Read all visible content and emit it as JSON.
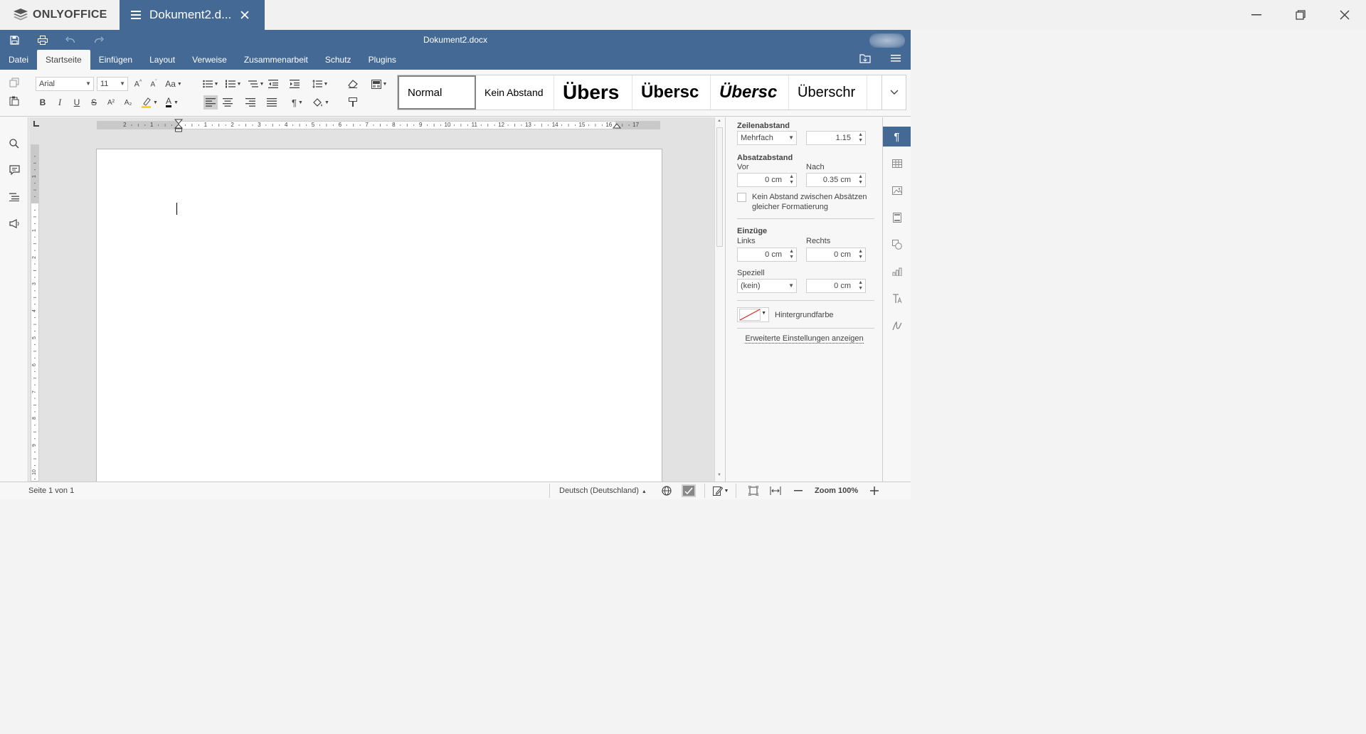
{
  "window": {
    "app_name": "ONLYOFFICE",
    "tab_title": "Dokument2.d..."
  },
  "header": {
    "doc_title": "Dokument2.docx",
    "tabs": [
      "Datei",
      "Startseite",
      "Einfügen",
      "Layout",
      "Verweise",
      "Zusammenarbeit",
      "Schutz",
      "Plugins"
    ],
    "active_tab": "Startseite"
  },
  "toolbar": {
    "font_name": "Arial",
    "font_size": "11",
    "case_label": "Aa",
    "bold": "B",
    "italic": "I",
    "underline": "U",
    "strike": "S",
    "superscript": "A²",
    "subscript": "A₂",
    "font_color_label": "A",
    "styles": [
      "Normal",
      "Kein Abstand",
      "Übers",
      "Übersc",
      "Übersc",
      "Überschr"
    ],
    "selected_style": "Normal"
  },
  "ruler": {
    "h_labels": [
      "2",
      "1",
      "1",
      "2",
      "3",
      "4",
      "5",
      "6",
      "7",
      "8",
      "9",
      "10",
      "11",
      "12",
      "13",
      "14",
      "15",
      "16",
      "17"
    ],
    "v_labels": [
      "1",
      "1",
      "2",
      "3",
      "4",
      "5",
      "6",
      "7",
      "8",
      "9",
      "10"
    ]
  },
  "right_panel": {
    "line_spacing_title": "Zeilenabstand",
    "line_spacing_mode": "Mehrfach",
    "line_spacing_value": "1.15",
    "para_spacing_title": "Absatzabstand",
    "before_label": "Vor",
    "after_label": "Nach",
    "before_value": "0 cm",
    "after_value": "0.35 cm",
    "no_space_checkbox": "Kein Abstand zwischen Absätzen gleicher Formatierung",
    "no_space_line1": "Kein Abstand zwischen Absätzen",
    "no_space_line2": "gleicher Formatierung",
    "indents_title": "Einzüge",
    "left_label": "Links",
    "right_label": "Rechts",
    "left_value": "0 cm",
    "right_value": "0 cm",
    "special_label": "Speziell",
    "special_mode": "(kein)",
    "special_value": "0 cm",
    "bg_color_label": "Hintergrundfarbe",
    "advanced_link": "Erweiterte Einstellungen anzeigen"
  },
  "status": {
    "page_info": "Seite 1 von 1",
    "language": "Deutsch (Deutschland)",
    "zoom": "Zoom 100%"
  },
  "colors": {
    "accent": "#446995",
    "highlight_yellow": "#ffd800",
    "font_color": "#000000"
  }
}
